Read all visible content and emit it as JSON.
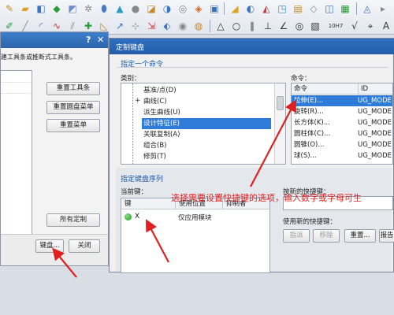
{
  "toolbar": {
    "label_10h7": "10H7"
  },
  "left_dialog": {
    "help_glyph": "?",
    "close_glyph": "✕",
    "description": "建工具条或推断式工具条。",
    "buttons": {
      "reset_toolbar": "重置工具条",
      "reset_popup_menu": "重置圆盘菜单",
      "reset_menu": "重置菜单",
      "all_customize": "所有定制",
      "keyboard": "键盘...",
      "close": "关闭"
    }
  },
  "right_dialog": {
    "title": "定制键盘",
    "specify_command": "指定一个命令",
    "category_label": "类别：",
    "command_label": "命令：",
    "categories": [
      {
        "label": "基准/点(D)",
        "selected": false,
        "expandable": false
      },
      {
        "label": "曲线(C)",
        "selected": false,
        "expandable": true
      },
      {
        "label": "派生曲线(U)",
        "selected": false,
        "expandable": false
      },
      {
        "label": "设计特征(E)",
        "selected": true,
        "expandable": false
      },
      {
        "label": "关联复制(A)",
        "selected": false,
        "expandable": false
      },
      {
        "label": "组合(B)",
        "selected": false,
        "expandable": false
      },
      {
        "label": "修剪(T)",
        "selected": false,
        "expandable": false
      }
    ],
    "command_columns": [
      "命令",
      "ID"
    ],
    "commands": [
      {
        "name": "拉伸(E)...",
        "id": "UG_MODE",
        "selected": true
      },
      {
        "name": "旋转(R)...",
        "id": "UG_MODE",
        "selected": false
      },
      {
        "name": "长方体(K)...",
        "id": "UG_MODE",
        "selected": false
      },
      {
        "name": "圆柱体(C)...",
        "id": "UG_MODE",
        "selected": false
      },
      {
        "name": "圆锥(O)...",
        "id": "UG_MODE",
        "selected": false
      },
      {
        "name": "球(S)...",
        "id": "UG_MODE",
        "selected": false
      }
    ],
    "specify_sequence": "指定键盘序列",
    "current_keys_label": "当前键：",
    "key_columns": [
      "键",
      "使用位置",
      "抑制者"
    ],
    "key_rows": [
      {
        "key": "X",
        "location": "仅应用模块",
        "suppressed_by": ""
      }
    ],
    "press_new_shortcut_label": "按新的快捷键：",
    "use_new_shortcut_label": "使用新的快捷键：",
    "buttons": {
      "assign": "指派",
      "remove": "移除",
      "reset": "重置...",
      "report": "报告"
    }
  },
  "annotation": {
    "text": "选择需要设置快捷键的选项，输入数字或字母可生",
    "color": "#e02020"
  },
  "colors": {
    "title_bar": "#2f6fbf",
    "selection": "#2f7bd8",
    "section_text": "#1f5aa8",
    "status_green": "#1c9a1c"
  }
}
